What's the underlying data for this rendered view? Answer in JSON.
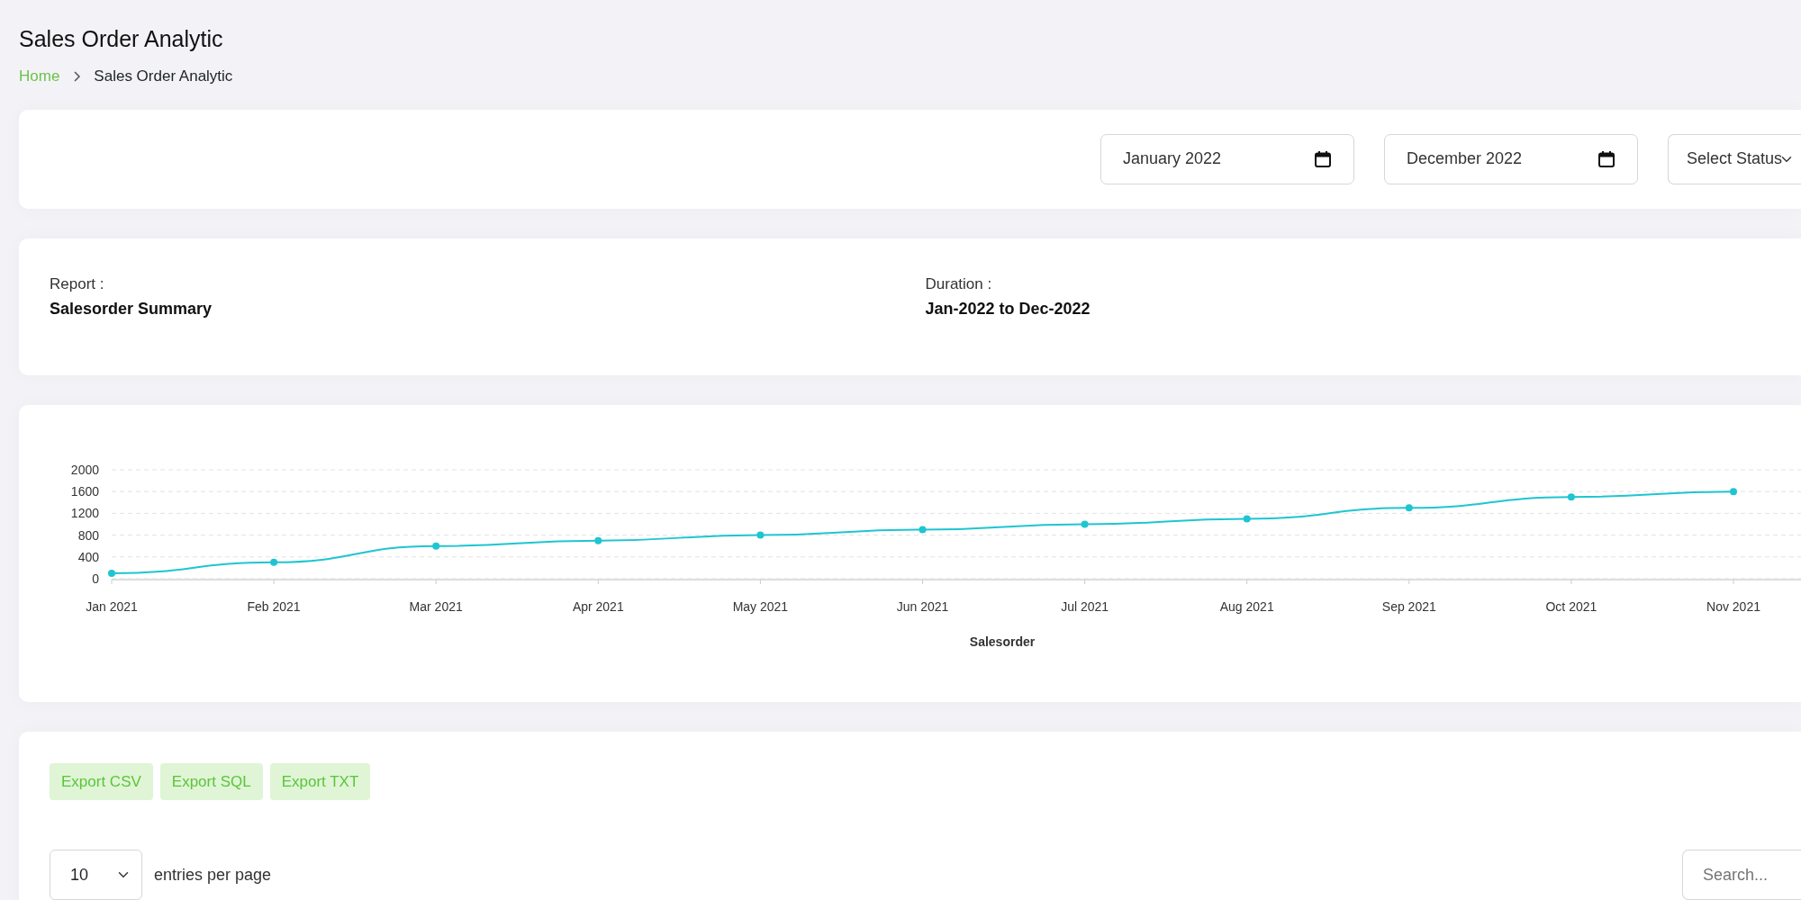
{
  "page_title": "Sales Order Analytic",
  "breadcrumb": [
    {
      "label": "Home",
      "kind": "link"
    },
    {
      "label": "Sales Order Analytic",
      "kind": "current"
    }
  ],
  "filters": {
    "start_month": "January 2022",
    "end_month": "December 2022",
    "status_select": {
      "placeholder": "Select Status"
    }
  },
  "report_info": [
    {
      "label": "Report :",
      "value": "Salesorder Summary"
    },
    {
      "label": "Duration :",
      "value": "Jan-2022 to Dec-2022"
    }
  ],
  "chart": {
    "chart_data": {
      "type": "line",
      "grid": true,
      "categories": [
        "Jan 2021",
        "Feb 2021",
        "Mar 2021",
        "Apr 2021",
        "May 2021",
        "Jun 2021",
        "Jul 2021",
        "Aug 2021",
        "Sep 2021",
        "Oct 2021",
        "Nov 2021"
      ],
      "series": [
        {
          "name": "Salesorder",
          "color": "#1fc5d1",
          "marker": true,
          "values": [
            100,
            300,
            600,
            700,
            800,
            900,
            1000,
            1100,
            1300,
            1500,
            1600
          ]
        }
      ],
      "ylim": [
        0,
        2000
      ],
      "yticks": [
        0,
        400,
        800,
        1200,
        1600,
        2000
      ]
    }
  },
  "table": {
    "export_buttons": [
      "Export CSV",
      "Export SQL",
      "Export TXT"
    ],
    "page_size": "10",
    "page_size_label": "entries per page",
    "search": {
      "placeholder": "Search..."
    }
  }
}
